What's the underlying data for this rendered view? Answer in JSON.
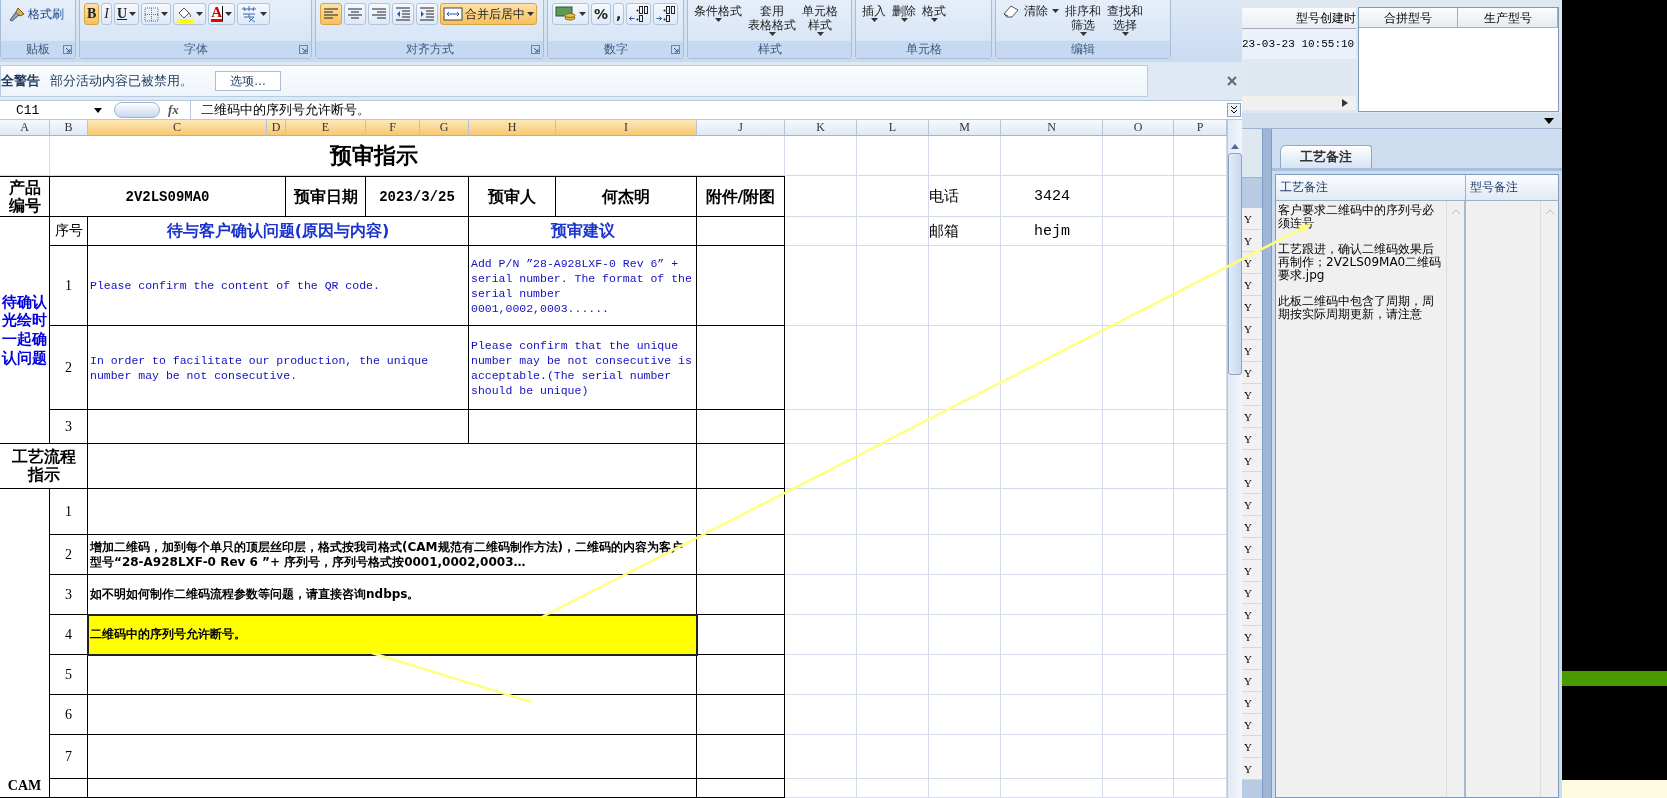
{
  "ribbon": {
    "groups": [
      {
        "label": "贴板",
        "buttons": [
          {
            "kind": "brush",
            "label": "格式刷",
            "on": false
          }
        ]
      },
      {
        "label": "字体",
        "buttons": [
          {
            "kind": "bold",
            "label": "B",
            "on": true
          },
          {
            "kind": "italic",
            "label": "I",
            "on": false
          },
          {
            "kind": "underline",
            "label": "U",
            "on": false
          },
          {
            "kind": "borders",
            "on": false
          },
          {
            "kind": "fill-color",
            "on": false
          },
          {
            "kind": "font-color",
            "label": "A",
            "on": false
          },
          {
            "kind": "phonetic",
            "on": false
          }
        ]
      },
      {
        "label": "对齐方式",
        "buttons": [
          {
            "kind": "align-left",
            "on": true
          },
          {
            "kind": "align-center",
            "on": false
          },
          {
            "kind": "align-right",
            "on": false
          },
          {
            "kind": "indent-decrease",
            "on": false
          },
          {
            "kind": "indent-increase",
            "on": false
          },
          {
            "kind": "merge",
            "label": "合并后居中",
            "on": true
          }
        ]
      },
      {
        "label": "数字",
        "buttons": [
          {
            "kind": "currency",
            "on": false
          },
          {
            "kind": "percent",
            "label": "%",
            "on": false
          },
          {
            "kind": "comma",
            "label": ",",
            "on": false
          },
          {
            "kind": "decimal-increase",
            "on": false
          },
          {
            "kind": "decimal-decrease",
            "on": false
          }
        ]
      },
      {
        "label": "样式",
        "buttons": [
          {
            "kind": "menu",
            "lines": [
              "条件格式"
            ],
            "on": false
          },
          {
            "kind": "menu",
            "lines": [
              "套用",
              "表格格式"
            ],
            "on": false
          },
          {
            "kind": "menu",
            "lines": [
              "单元格",
              "样式"
            ],
            "on": false
          }
        ]
      },
      {
        "label": "单元格",
        "buttons": [
          {
            "kind": "menu",
            "lines": [
              "插入"
            ],
            "on": false
          },
          {
            "kind": "menu",
            "lines": [
              "删除"
            ],
            "on": false
          },
          {
            "kind": "menu",
            "lines": [
              "格式"
            ],
            "on": false
          }
        ]
      },
      {
        "label": "编辑",
        "buttons": [
          {
            "kind": "clear",
            "label": "清除",
            "on": false
          },
          {
            "kind": "menu",
            "lines": [
              "排序和",
              "筛选"
            ],
            "on": false
          },
          {
            "kind": "menu",
            "lines": [
              "查找和",
              "选择"
            ],
            "on": false
          }
        ]
      }
    ]
  },
  "security_bar": {
    "title": "全警告",
    "message": "部分活动内容已被禁用。",
    "button": "选项..."
  },
  "formula_bar": {
    "cell": "C11",
    "function_label": "fx",
    "content": "二维码中的序列号允许断号。"
  },
  "columns": [
    {
      "label": "A",
      "selected": false
    },
    {
      "label": "B",
      "selected": false
    },
    {
      "label": "C",
      "selected": true
    },
    {
      "label": "D",
      "selected": true
    },
    {
      "label": "E",
      "selected": true
    },
    {
      "label": "F",
      "selected": true
    },
    {
      "label": "G",
      "selected": true
    },
    {
      "label": "H",
      "selected": true
    },
    {
      "label": "I",
      "selected": true
    },
    {
      "label": "J",
      "selected": false
    },
    {
      "label": "K",
      "selected": false
    },
    {
      "label": "L",
      "selected": false
    },
    {
      "label": "M",
      "selected": false
    },
    {
      "label": "N",
      "selected": false
    },
    {
      "label": "O",
      "selected": false
    },
    {
      "label": "P",
      "selected": false
    }
  ],
  "sheet": {
    "title": "预审指示",
    "product": {
      "label": "产品编号",
      "code": "2V2LS09MA0",
      "date_label": "预审日期",
      "date": "2023/3/25",
      "reviewer_label": "预审人",
      "reviewer": "何杰明",
      "attachment_label": "附件/附图"
    },
    "contact": [
      {
        "label": "电话",
        "value": "3424"
      },
      {
        "label": "邮箱",
        "value": "hejm"
      }
    ],
    "questions_section": "待确认光绘时一起确认问题",
    "index_header": "序号",
    "question_header": "待与客户确认问题(原因与内容)",
    "suggestion_header": "预审建议",
    "questions": [
      {
        "no": "1",
        "question": "Please confirm the content of the QR code.",
        "suggestion": "Add P/N ”28-A928LXF-0 Rev 6” + serial number. The format of the serial number 0001,0002,0003......"
      },
      {
        "no": "2",
        "question": "In order to facilitate our production, the unique number may be not consecutive.",
        "suggestion": "Please confirm that the unique number may be not consecutive is acceptable.(The serial number should be unique)"
      },
      {
        "no": "3"
      }
    ],
    "process_section": "工艺流程指示",
    "cam_section": "CAM",
    "steps": [
      {
        "no": "1",
        "highlighted": false,
        "selected": false
      },
      {
        "no": "2",
        "text": "增加二维码，加到每个单只的顶层丝印层，格式按我司格式(CAM规范有二维码制作方法)，二维码的内容为客户型号“28-A928LXF-0 Rev 6 ”+ 序列号，序列号格式按0001,0002,0003…",
        "highlighted": false,
        "selected": false
      },
      {
        "no": "3",
        "text": "如不明如何制作二维码流程参数等问题，请直接咨询ndbps。",
        "highlighted": false,
        "selected": false
      },
      {
        "no": "4",
        "text": "二维码中的序列号允许断号。",
        "highlighted": true,
        "selected": true
      },
      {
        "no": "5",
        "highlighted": false,
        "selected": false
      },
      {
        "no": "6",
        "highlighted": false,
        "selected": false
      },
      {
        "no": "7",
        "highlighted": false,
        "selected": false
      }
    ]
  },
  "right_panel": {
    "columns": [
      "型号创建时",
      "合拼型号",
      "生产型号"
    ],
    "created": "23-03-23 10:55:10",
    "flags": [
      "Y",
      "Y",
      "Y",
      "Y",
      "Y",
      "Y",
      "Y",
      "Y",
      "Y",
      "Y",
      "Y",
      "Y",
      "Y",
      "Y",
      "Y",
      "Y",
      "Y",
      "Y",
      "Y",
      "Y",
      "Y",
      "Y",
      "Y",
      "Y",
      "Y",
      "Y"
    ],
    "tab": {
      "label": "工艺备注",
      "selected": true
    },
    "notes_columns": [
      "工艺备注",
      "型号备注"
    ],
    "notes": [
      "客户要求二维码中的序列号必须连号",
      "工艺跟进，确认二维码效果后再制作；2V2LS09MA0二维码要求.jpg",
      "此板二维码中包含了周期，周期按实际周期更新，请注意"
    ]
  }
}
